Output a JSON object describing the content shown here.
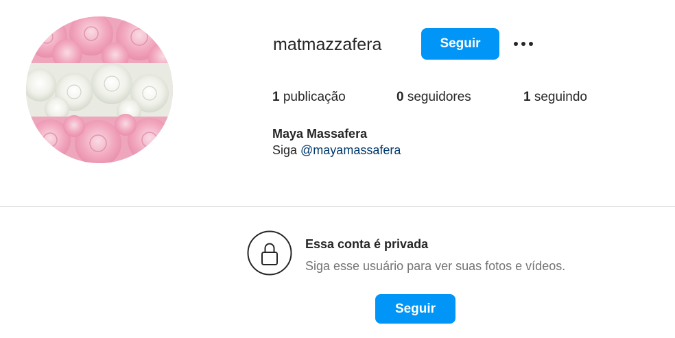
{
  "profile": {
    "username": "matmazzafera",
    "follow_label": "Seguir",
    "more_icon": "more-options-icon",
    "avatar_icon": "profile-avatar-roses"
  },
  "stats": [
    {
      "count": "1",
      "label": " publicação"
    },
    {
      "count": "0",
      "label": " seguidores"
    },
    {
      "count": "1",
      "label": " seguindo"
    }
  ],
  "bio": {
    "full_name": "Maya Massafera",
    "prefix": "Siga ",
    "mention": "@mayamassafera"
  },
  "private": {
    "title": "Essa conta é privada",
    "subtitle": "Siga esse usuário para ver suas fotos e vídeos.",
    "follow_label": "Seguir",
    "icon": "lock-icon"
  },
  "colors": {
    "accent": "#0095f6",
    "mention": "#00376b",
    "muted": "#737373",
    "divider": "#dbdbdb"
  }
}
